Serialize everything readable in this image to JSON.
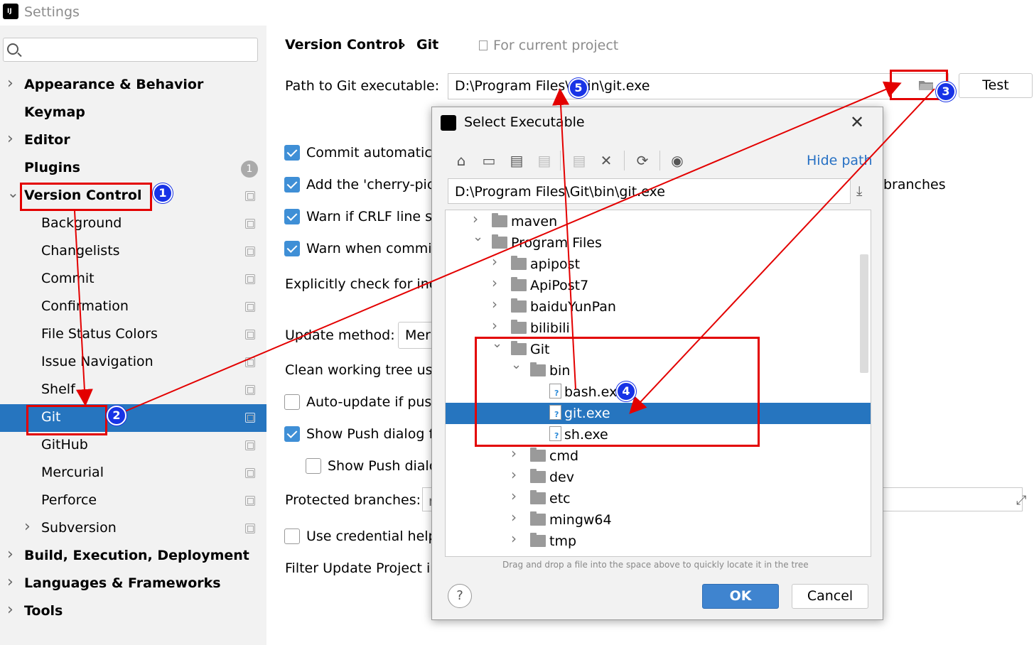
{
  "window": {
    "title": "Settings",
    "logo_text": "IJ"
  },
  "search": {
    "placeholder": ""
  },
  "sidebar": {
    "items": [
      {
        "label": "Appearance & Behavior",
        "level": 0,
        "bold": true,
        "chevron": "right"
      },
      {
        "label": "Keymap",
        "level": 0,
        "bold": true,
        "chevron": ""
      },
      {
        "label": "Editor",
        "level": 0,
        "bold": true,
        "chevron": "right"
      },
      {
        "label": "Plugins",
        "level": 0,
        "bold": true,
        "chevron": "",
        "badge": "1"
      },
      {
        "label": "Version Control",
        "level": 0,
        "bold": true,
        "chevron": "down",
        "proj": true
      },
      {
        "label": "Background",
        "level": 1,
        "proj": true
      },
      {
        "label": "Changelists",
        "level": 1,
        "proj": true
      },
      {
        "label": "Commit",
        "level": 1,
        "proj": true
      },
      {
        "label": "Confirmation",
        "level": 1,
        "proj": true
      },
      {
        "label": "File Status Colors",
        "level": 1,
        "proj": true
      },
      {
        "label": "Issue Navigation",
        "level": 1,
        "proj": true
      },
      {
        "label": "Shelf",
        "level": 1,
        "proj": true
      },
      {
        "label": "Git",
        "level": 1,
        "proj": true,
        "selected": true
      },
      {
        "label": "GitHub",
        "level": 1,
        "proj": true
      },
      {
        "label": "Mercurial",
        "level": 1,
        "proj": true
      },
      {
        "label": "Perforce",
        "level": 1,
        "proj": true
      },
      {
        "label": "Subversion",
        "level": 1,
        "proj": true,
        "chevron": "right"
      },
      {
        "label": "Build, Execution, Deployment",
        "level": 0,
        "bold": true,
        "chevron": "right"
      },
      {
        "label": "Languages & Frameworks",
        "level": 0,
        "bold": true,
        "chevron": "right"
      },
      {
        "label": "Tools",
        "level": 0,
        "bold": true,
        "chevron": "right"
      }
    ]
  },
  "content": {
    "breadcrumb_parent": "Version Control",
    "breadcrumb_sep": "›",
    "breadcrumb_current": "Git",
    "scope_label": "For current project",
    "path_label": "Path to Git executable:",
    "path_value": "D:\\Program Files\\     \\bin\\git.exe",
    "test_label": "Test",
    "commit_auto": "Commit automatica",
    "cherry_pick": "Add the 'cherry-pic",
    "cherry_pick_tail": "branches",
    "crlf": "Warn if CRLF line se",
    "warn_commit": "Warn when commit",
    "explicit_check": "Explicitly check for inc",
    "update_method_label": "Update method:",
    "update_method_value": "Mer",
    "clean_tree": "Clean working tree usi",
    "auto_update": "Auto-update if push",
    "show_push": "Show Push dialog f",
    "show_push_sub": "Show Push dialo",
    "protected_label": "Protected branches:",
    "protected_value": "r",
    "credential": "Use credential help",
    "filter_update": "Filter Update Project in"
  },
  "dialog": {
    "title": "Select Executable",
    "close": "✕",
    "hide_path": "Hide path",
    "path_value": "D:\\Program Files\\Git\\bin\\git.exe",
    "toolbar_icons": [
      "home-icon",
      "desktop-icon",
      "project-folder-icon",
      "module-folder-icon",
      "new-folder-icon",
      "delete-icon",
      "refresh-icon",
      "show-hidden-icon"
    ],
    "tree": [
      {
        "label": "maven",
        "depth": 0,
        "chevron": "right",
        "type": "folder"
      },
      {
        "label": "Program Files",
        "depth": 0,
        "chevron": "down",
        "type": "folder"
      },
      {
        "label": "apipost",
        "depth": 1,
        "chevron": "right",
        "type": "folder"
      },
      {
        "label": "ApiPost7",
        "depth": 1,
        "chevron": "right",
        "type": "folder"
      },
      {
        "label": "baiduYunPan",
        "depth": 1,
        "chevron": "right",
        "type": "folder"
      },
      {
        "label": "bilibili",
        "depth": 1,
        "chevron": "right",
        "type": "folder"
      },
      {
        "label": "Git",
        "depth": 1,
        "chevron": "down",
        "type": "folder"
      },
      {
        "label": "bin",
        "depth": 2,
        "chevron": "down",
        "type": "folder"
      },
      {
        "label": "bash.exe",
        "depth": 3,
        "chevron": "",
        "type": "file"
      },
      {
        "label": "git.exe",
        "depth": 3,
        "chevron": "",
        "type": "file",
        "selected": true
      },
      {
        "label": "sh.exe",
        "depth": 3,
        "chevron": "",
        "type": "file"
      },
      {
        "label": "cmd",
        "depth": 2,
        "chevron": "right",
        "type": "folder"
      },
      {
        "label": "dev",
        "depth": 2,
        "chevron": "right",
        "type": "folder"
      },
      {
        "label": "etc",
        "depth": 2,
        "chevron": "right",
        "type": "folder"
      },
      {
        "label": "mingw64",
        "depth": 2,
        "chevron": "right",
        "type": "folder"
      },
      {
        "label": "tmp",
        "depth": 2,
        "chevron": "right",
        "type": "folder"
      }
    ],
    "hint": "Drag and drop a file into the space above to quickly locate it in the tree",
    "help": "?",
    "ok": "OK",
    "cancel": "Cancel"
  },
  "annotations": {
    "markers": [
      "1",
      "2",
      "3",
      "4",
      "5"
    ],
    "color": "#e30000",
    "marker_color": "#1833e6"
  },
  "colors": {
    "selection": "#2675bf",
    "checkbox": "#3f8fd6",
    "link": "#2670c4",
    "sidebar_bg": "#f2f2f2"
  }
}
